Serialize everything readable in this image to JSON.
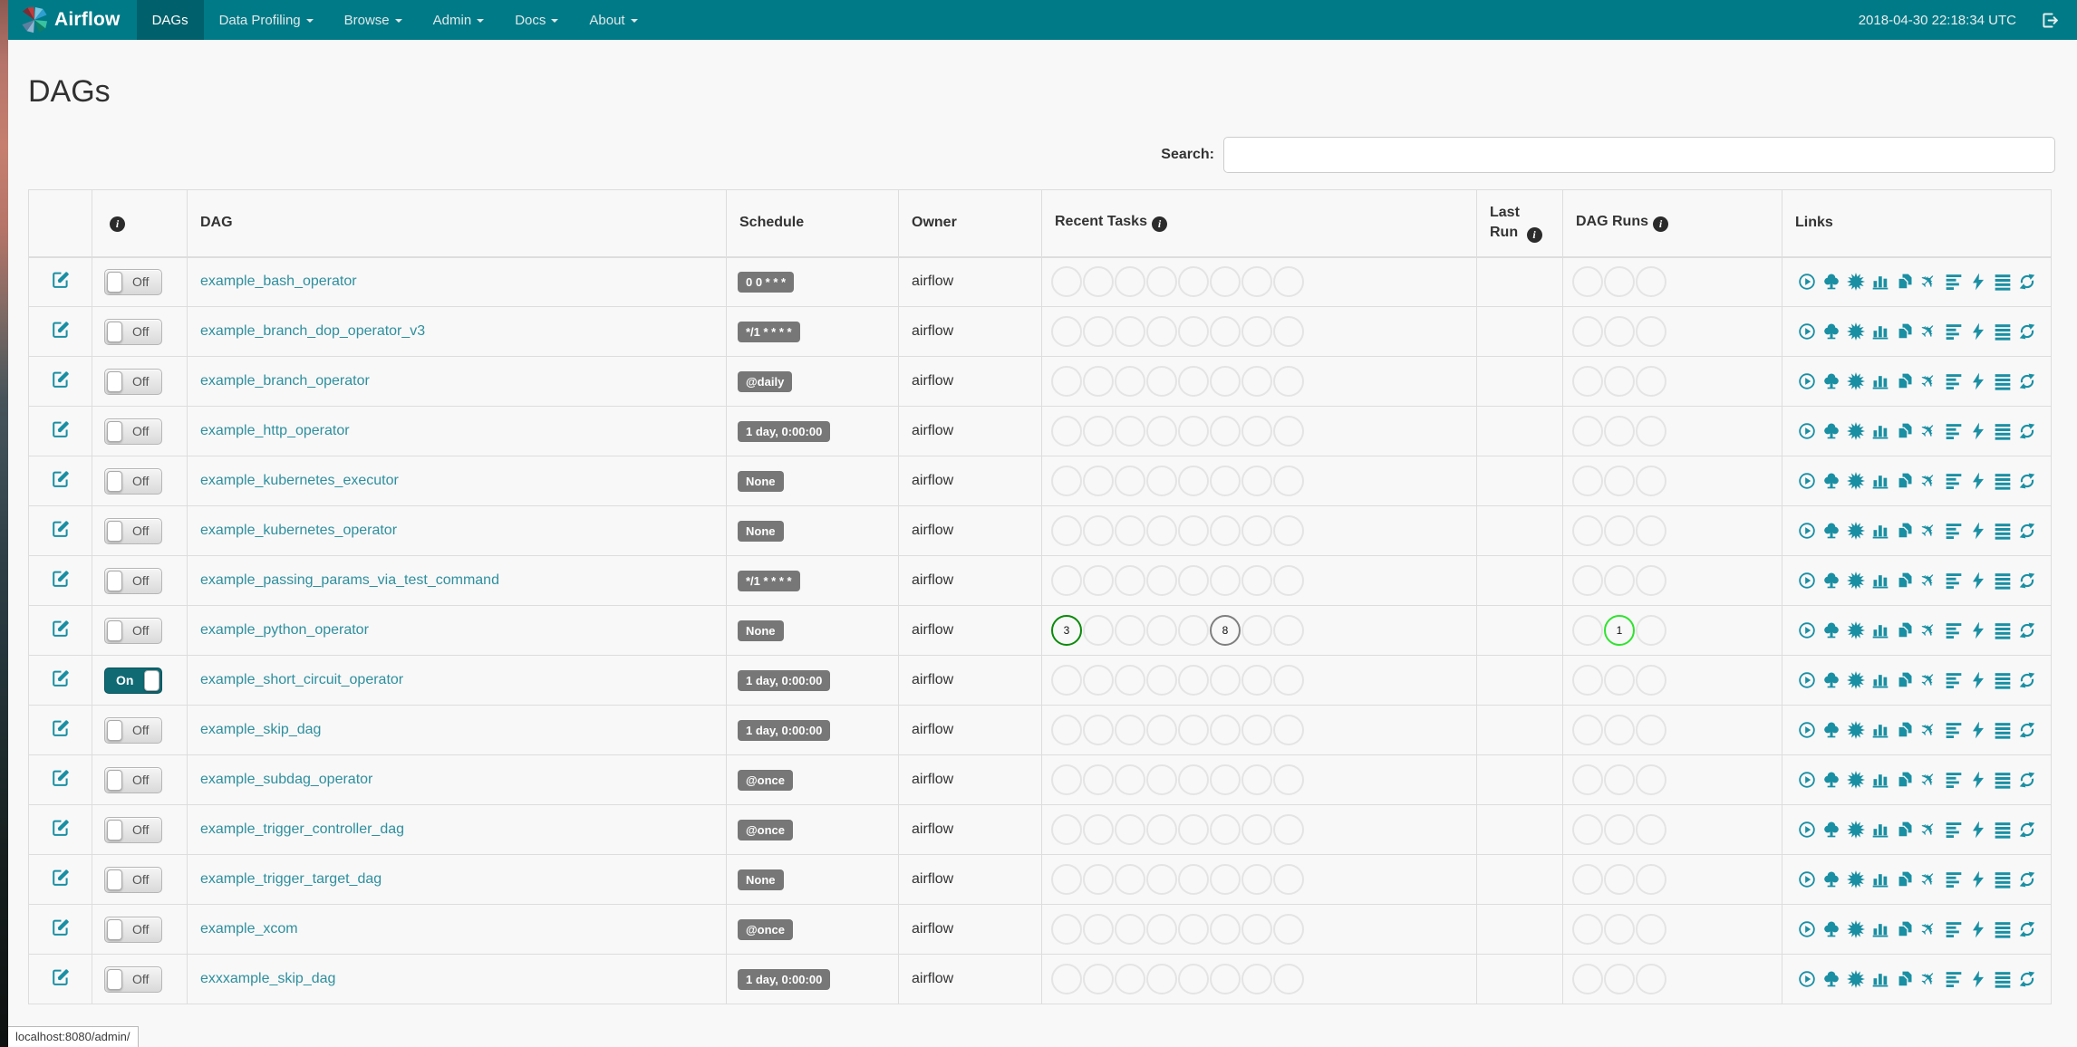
{
  "navbar": {
    "brand": "Airflow",
    "items": [
      {
        "label": "DAGs",
        "active": true,
        "caret": false
      },
      {
        "label": "Data Profiling",
        "active": false,
        "caret": true
      },
      {
        "label": "Browse",
        "active": false,
        "caret": true
      },
      {
        "label": "Admin",
        "active": false,
        "caret": true
      },
      {
        "label": "Docs",
        "active": false,
        "caret": true
      },
      {
        "label": "About",
        "active": false,
        "caret": true
      }
    ],
    "clock": "2018-04-30 22:18:34 UTC",
    "logout_icon": "logout-icon"
  },
  "page": {
    "title": "DAGs"
  },
  "search": {
    "label": "Search:",
    "value": ""
  },
  "table": {
    "headers": {
      "info_icon": "i",
      "dag": "DAG",
      "schedule": "Schedule",
      "owner": "Owner",
      "recent_tasks": "Recent Tasks",
      "last_run_line1": "Last",
      "last_run_line2": "Run",
      "dag_runs": "DAG Runs",
      "links": "Links"
    },
    "recent_task_slots": 8,
    "dag_run_slots": 3,
    "links_icons": [
      "trigger-dag",
      "tree-view",
      "graph-view",
      "task-duration",
      "task-tries",
      "landing-times",
      "gantt",
      "code",
      "logs",
      "refresh"
    ],
    "toggle_labels": {
      "on": "On",
      "off": "Off"
    },
    "rows": [
      {
        "toggle": "Off",
        "dag": "example_bash_operator",
        "schedule": "0 0 * * *",
        "owner": "airflow",
        "recent_tasks": [],
        "dag_runs": []
      },
      {
        "toggle": "Off",
        "dag": "example_branch_dop_operator_v3",
        "schedule": "*/1 * * * *",
        "owner": "airflow",
        "recent_tasks": [],
        "dag_runs": []
      },
      {
        "toggle": "Off",
        "dag": "example_branch_operator",
        "schedule": "@daily",
        "owner": "airflow",
        "recent_tasks": [],
        "dag_runs": []
      },
      {
        "toggle": "Off",
        "dag": "example_http_operator",
        "schedule": "1 day, 0:00:00",
        "owner": "airflow",
        "recent_tasks": [],
        "dag_runs": []
      },
      {
        "toggle": "Off",
        "dag": "example_kubernetes_executor",
        "schedule": "None",
        "owner": "airflow",
        "recent_tasks": [],
        "dag_runs": []
      },
      {
        "toggle": "Off",
        "dag": "example_kubernetes_operator",
        "schedule": "None",
        "owner": "airflow",
        "recent_tasks": [],
        "dag_runs": []
      },
      {
        "toggle": "Off",
        "dag": "example_passing_params_via_test_command",
        "schedule": "*/1 * * * *",
        "owner": "airflow",
        "recent_tasks": [],
        "dag_runs": []
      },
      {
        "toggle": "Off",
        "dag": "example_python_operator",
        "schedule": "None",
        "owner": "airflow",
        "recent_tasks": [
          {
            "slot": 1,
            "count": 3,
            "state": "success",
            "color": "#0b8a0b"
          },
          {
            "slot": 6,
            "count": 8,
            "state": "queued",
            "color": "#7f7f7f"
          }
        ],
        "dag_runs": [
          {
            "slot": 2,
            "count": 1,
            "state": "running",
            "color": "#2fe32f"
          }
        ]
      },
      {
        "toggle": "On",
        "dag": "example_short_circuit_operator",
        "schedule": "1 day, 0:00:00",
        "owner": "airflow",
        "recent_tasks": [],
        "dag_runs": []
      },
      {
        "toggle": "Off",
        "dag": "example_skip_dag",
        "schedule": "1 day, 0:00:00",
        "owner": "airflow",
        "recent_tasks": [],
        "dag_runs": []
      },
      {
        "toggle": "Off",
        "dag": "example_subdag_operator",
        "schedule": "@once",
        "owner": "airflow",
        "recent_tasks": [],
        "dag_runs": []
      },
      {
        "toggle": "Off",
        "dag": "example_trigger_controller_dag",
        "schedule": "@once",
        "owner": "airflow",
        "recent_tasks": [],
        "dag_runs": []
      },
      {
        "toggle": "Off",
        "dag": "example_trigger_target_dag",
        "schedule": "None",
        "owner": "airflow",
        "recent_tasks": [],
        "dag_runs": []
      },
      {
        "toggle": "Off",
        "dag": "example_xcom",
        "schedule": "@once",
        "owner": "airflow",
        "recent_tasks": [],
        "dag_runs": []
      },
      {
        "toggle": "Off",
        "dag": "exxxample_skip_dag",
        "schedule": "1 day, 0:00:00",
        "owner": "airflow",
        "recent_tasks": [],
        "dag_runs": []
      }
    ]
  },
  "status_bar": {
    "text": "localhost:8080/admin/"
  },
  "colors": {
    "navbar_bg": "#007a87",
    "navbar_active_bg": "#00606b",
    "link_teal": "#2e8f9e",
    "icon_teal": "#1a8fa3",
    "badge_bg": "#777777",
    "task_success": "#0b8a0b",
    "task_queued": "#7f7f7f",
    "run_running": "#2fe32f",
    "empty_circle_border": "#e4e4e4"
  }
}
